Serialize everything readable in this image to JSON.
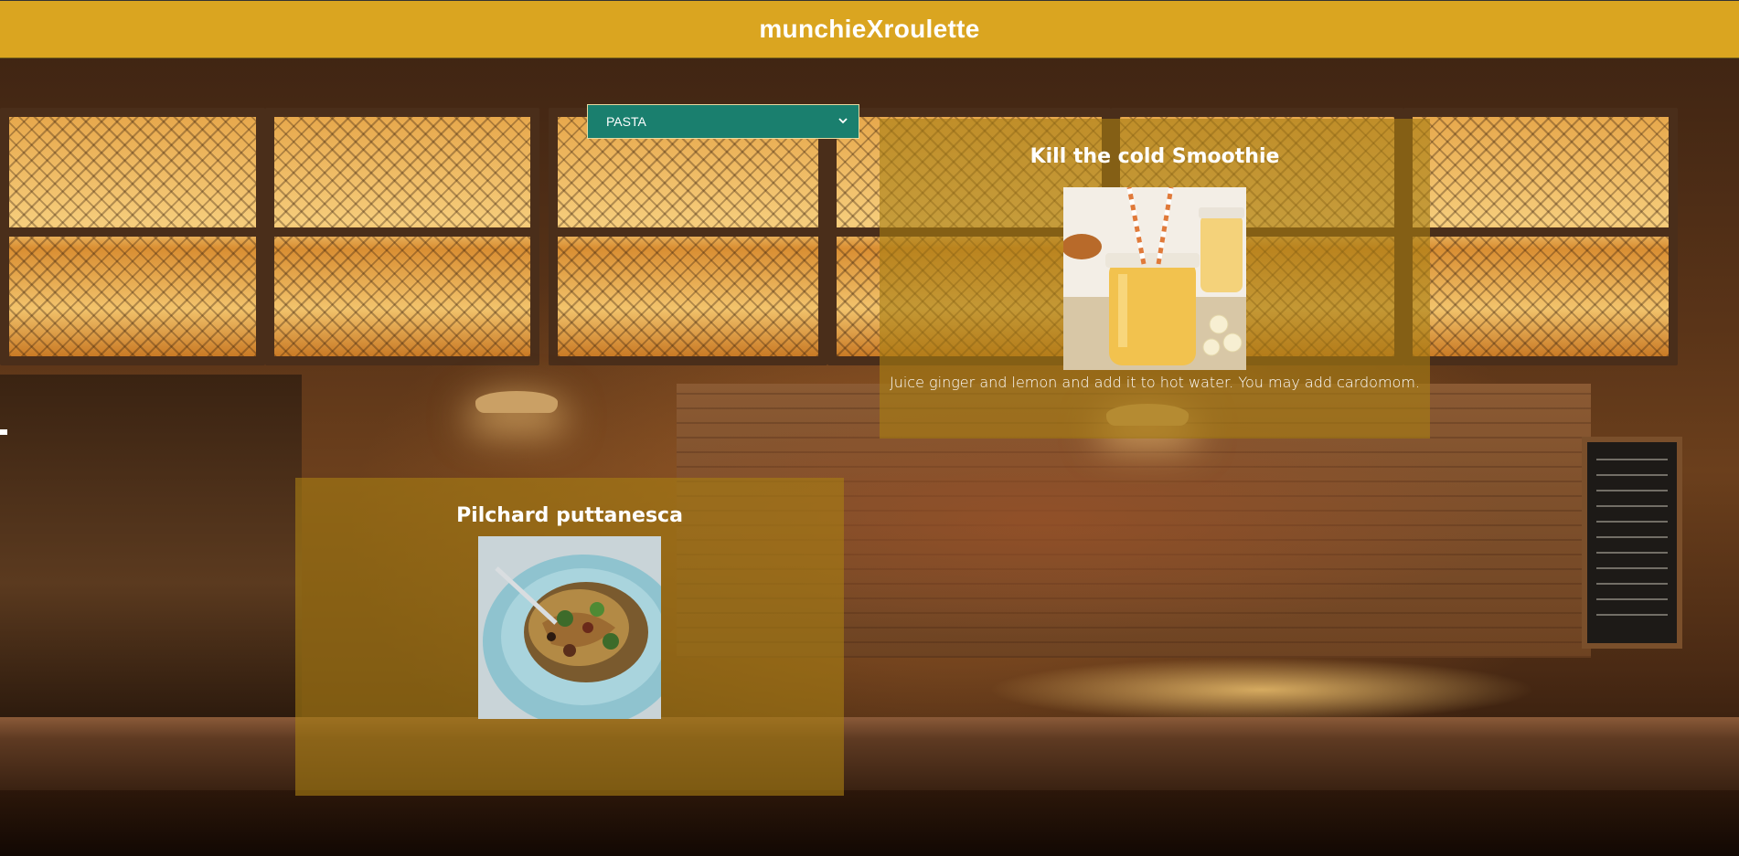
{
  "header": {
    "title": "munchieXroulette"
  },
  "category_select": {
    "selected": "PASTA"
  },
  "recipes": [
    {
      "title": "Kill the cold Smoothie",
      "image": "smoothie-photo",
      "description": "Juice ginger and lemon and add it to hot water. You may add cardomom."
    },
    {
      "title": "Pilchard puttanesca",
      "image": "pasta-photo",
      "description": ""
    }
  ],
  "colors": {
    "header_bg": "#daa520",
    "select_bg": "#1a7f6e",
    "card_bg": "rgba(168,126,20,0.62)",
    "text": "#ffffff"
  }
}
